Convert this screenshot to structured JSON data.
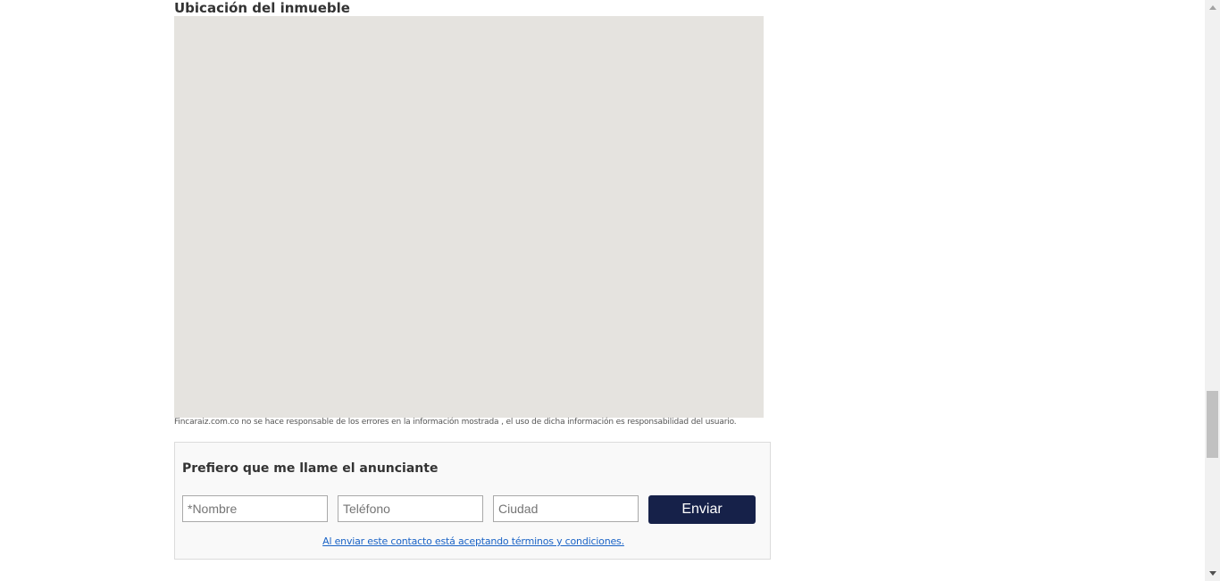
{
  "location": {
    "title": "Ubicación del inmueble",
    "disclaimer": "Fincaraiz.com.co no se hace responsable de los errores en la información mostrada , el uso de dicha información es responsabilidad del usuario."
  },
  "contact_form": {
    "title": "Prefiero que me llame el anunciante",
    "name_placeholder": "*Nombre",
    "phone_placeholder": "Teléfono",
    "city_placeholder": "Ciudad",
    "send_label": "Enviar",
    "terms_link": "Al enviar este contacto está aceptando términos y condiciones."
  },
  "colors": {
    "map_background": "#e5e3df",
    "button_background": "#162149",
    "link": "#1a63c6"
  },
  "icons": {
    "scroll_up": "triangle-up-icon",
    "scroll_down": "triangle-down-icon"
  }
}
